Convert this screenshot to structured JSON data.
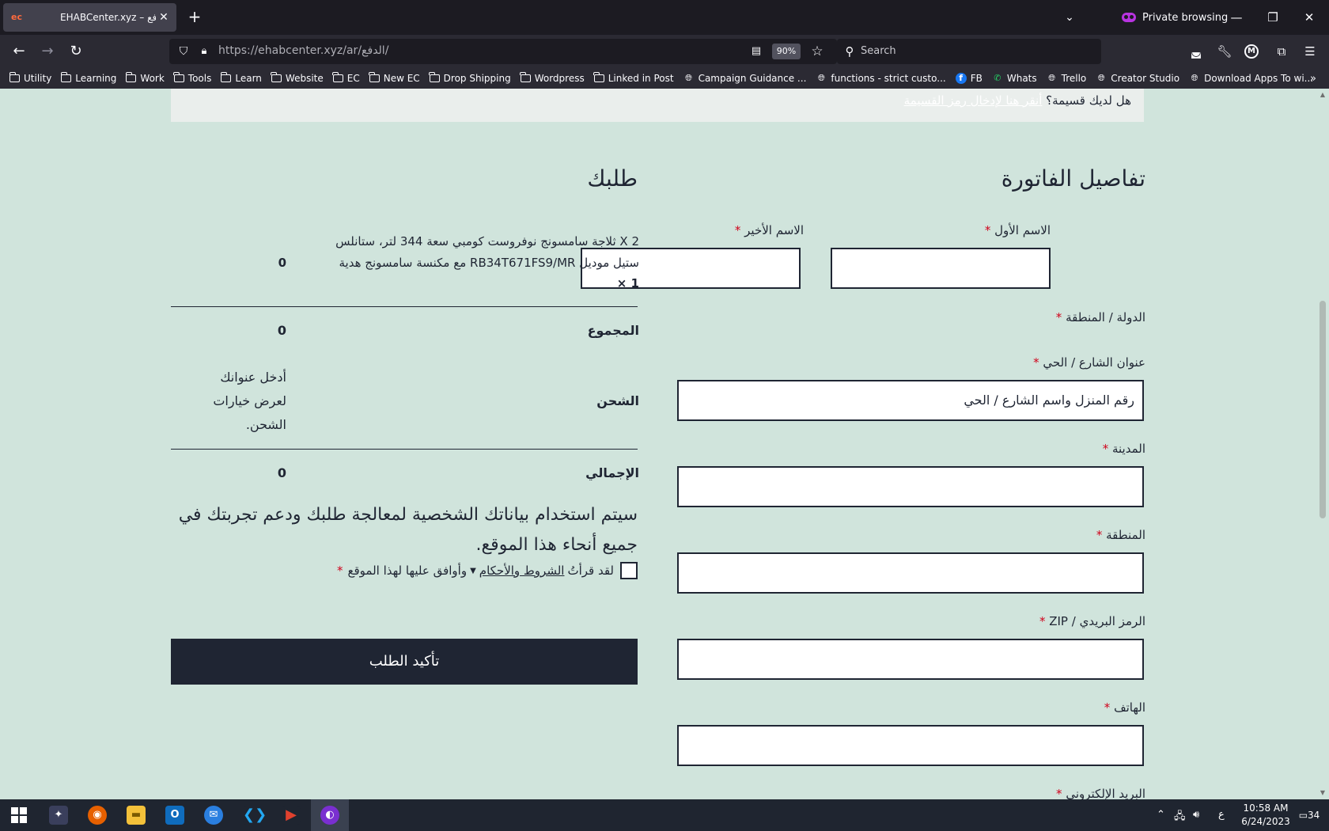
{
  "browser": {
    "tab_title": "EHABCenter.xyz – الدفع",
    "tab_favicon": "ec",
    "private_label": "Private browsing",
    "url_host": "https://ehabcenter.xyz",
    "url_path": "/ar/الدفع/",
    "zoom": "90%",
    "search_placeholder": "Search",
    "account_initial": "M"
  },
  "bookmarks": [
    {
      "label": "Utility",
      "icon": "folder-icon"
    },
    {
      "label": "Learning",
      "icon": "folder-icon"
    },
    {
      "label": "Work",
      "icon": "folder-icon"
    },
    {
      "label": "Tools",
      "icon": "folder-icon"
    },
    {
      "label": "Learn",
      "icon": "folder-icon"
    },
    {
      "label": "Website",
      "icon": "folder-icon"
    },
    {
      "label": "EC",
      "icon": "folder-icon"
    },
    {
      "label": "New EC",
      "icon": "folder-icon"
    },
    {
      "label": "Drop Shipping",
      "icon": "folder-icon"
    },
    {
      "label": "Wordpress",
      "icon": "folder-icon"
    },
    {
      "label": "Linked in Post",
      "icon": "folder-icon"
    },
    {
      "label": "Campaign Guidance ...",
      "icon": "globe-icon"
    },
    {
      "label": "functions - strict custo...",
      "icon": "globe-icon"
    },
    {
      "label": "FB",
      "icon": "facebook-icon"
    },
    {
      "label": "Whats",
      "icon": "whatsapp-icon"
    },
    {
      "label": "Trello",
      "icon": "globe-icon"
    },
    {
      "label": "Creator Studio",
      "icon": "globe-icon"
    },
    {
      "label": "Download Apps To wi...",
      "icon": "globe-icon"
    }
  ],
  "page": {
    "coupon_question": "هل لديك قسيمة؟",
    "coupon_link": "أنقر هنا لإدخال رمز القسيمة",
    "billing_heading": "تفاصيل الفاتورة",
    "order_heading": "طلبك",
    "required_mark": "*",
    "fields": {
      "first_name": "الاسم الأول",
      "last_name": "الاسم الأخير",
      "country": "الدولة / المنطقة",
      "street": "عنوان الشارع / الحي",
      "street_value": "رقم المنزل واسم الشارع / الحي",
      "city": "المدينة",
      "region": "المنطقة",
      "zip": "الرمز البريدي / ZIP",
      "phone": "الهاتف",
      "email": "البريد الإلكتروني"
    },
    "order": {
      "product": "2 X ثلاجة سامسونج نوفروست كومبي سعة 344 لتر، ستانلس ستيل موديل RB34T671FS9/MR مع مكنسة سامسونج هدية",
      "product_qty": "× 1",
      "product_price": "0",
      "subtotal_label": "المجموع",
      "subtotal_value": "0",
      "shipping_label": "الشحن",
      "shipping_note": "أدخل عنوانك لعرض خيارات الشحن.",
      "total_label": "الإجمالي",
      "total_value": "0"
    },
    "privacy_text": "سيتم استخدام بياناتك الشخصية لمعالجة طلبك ودعم تجربتك في جميع أنحاء هذا الموقع.",
    "terms_prefix": "لقد قرأتُ",
    "terms_link": "الشروط والأحكام",
    "terms_suffix": "وأوافق عليها لهذا الموقع",
    "place_order": "تأكيد الطلب"
  },
  "taskbar": {
    "lang": "ع",
    "time": "10:58 AM",
    "date": "6/24/2023",
    "notifications": "34"
  },
  "colors": {
    "page_bg": "#d0e4dc",
    "primary_dark": "#1f2533",
    "required": "#d0021b",
    "coupon_bg": "#eaeeec"
  }
}
